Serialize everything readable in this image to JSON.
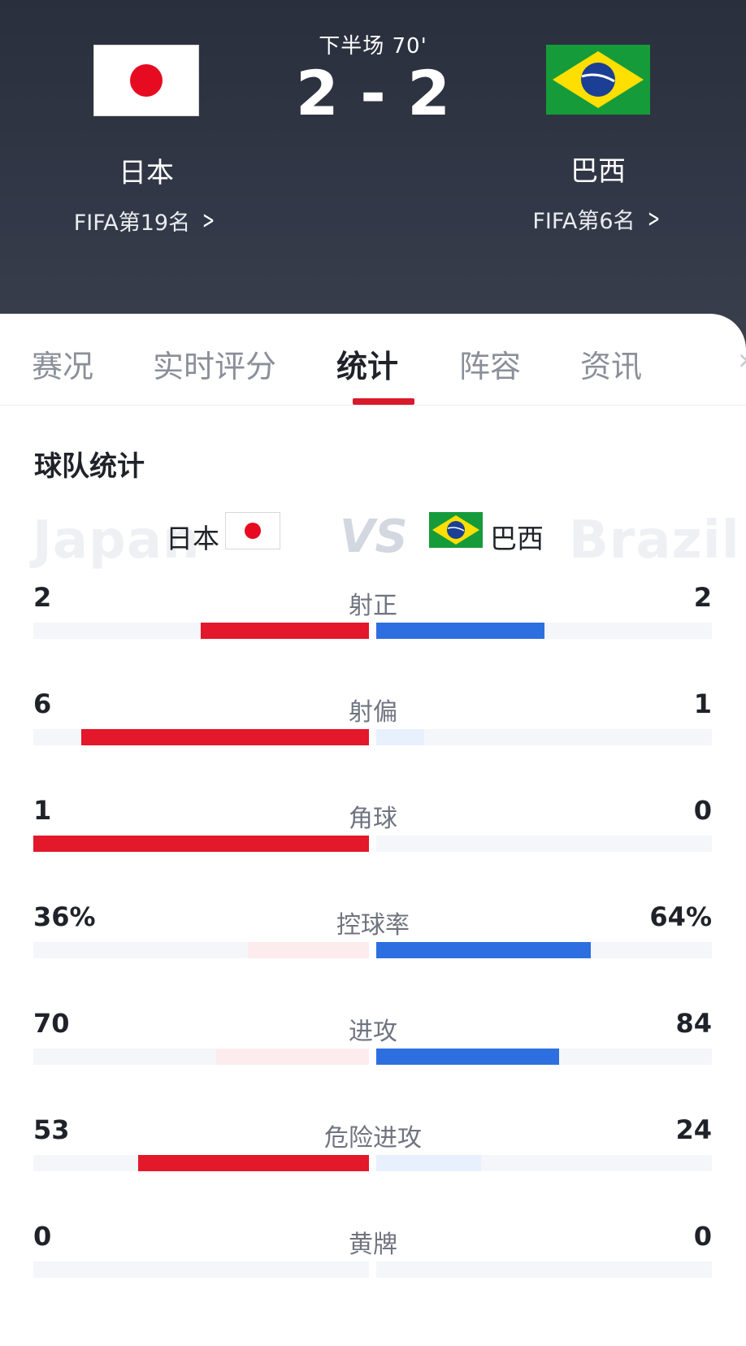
{
  "match": {
    "period": "下半场 70'",
    "score": "2 - 2",
    "home": {
      "name": "日本",
      "rank": "FIFA第19名"
    },
    "away": {
      "name": "巴西",
      "rank": "FIFA第6名"
    }
  },
  "tabs": [
    "赛况",
    "实时评分",
    "统计",
    "阵容",
    "资讯"
  ],
  "active_tab": "统计",
  "section_title": "球队统计",
  "vs": {
    "home_watermark": "Japan",
    "away_watermark": "Brazil",
    "vs_text": "VS",
    "home_name": "日本",
    "away_name": "巴西"
  },
  "colors": {
    "home": "#e3182b",
    "away": "#2d6fe0",
    "header_bg": "#2f3442",
    "active_tab_indicator": "#d91a2a"
  },
  "stats": [
    {
      "label": "射正",
      "home": "2",
      "away": "2",
      "home_share": 0.5,
      "away_share": 0.5,
      "home_leads": true,
      "away_leads": true
    },
    {
      "label": "射偏",
      "home": "6",
      "away": "1",
      "home_share": 0.857,
      "away_share": 0.143,
      "home_leads": true,
      "away_leads": false
    },
    {
      "label": "角球",
      "home": "1",
      "away": "0",
      "home_share": 1.0,
      "away_share": 0.0,
      "home_leads": true,
      "away_leads": false
    },
    {
      "label": "控球率",
      "home": "36%",
      "away": "64%",
      "home_share": 0.36,
      "away_share": 0.64,
      "home_leads": false,
      "away_leads": true
    },
    {
      "label": "进攻",
      "home": "70",
      "away": "84",
      "home_share": 0.455,
      "away_share": 0.545,
      "home_leads": false,
      "away_leads": true
    },
    {
      "label": "危险进攻",
      "home": "53",
      "away": "24",
      "home_share": 0.688,
      "away_share": 0.312,
      "home_leads": true,
      "away_leads": false
    },
    {
      "label": "黄牌",
      "home": "0",
      "away": "0",
      "home_share": 0,
      "away_share": 0,
      "home_leads": false,
      "away_leads": false
    }
  ]
}
